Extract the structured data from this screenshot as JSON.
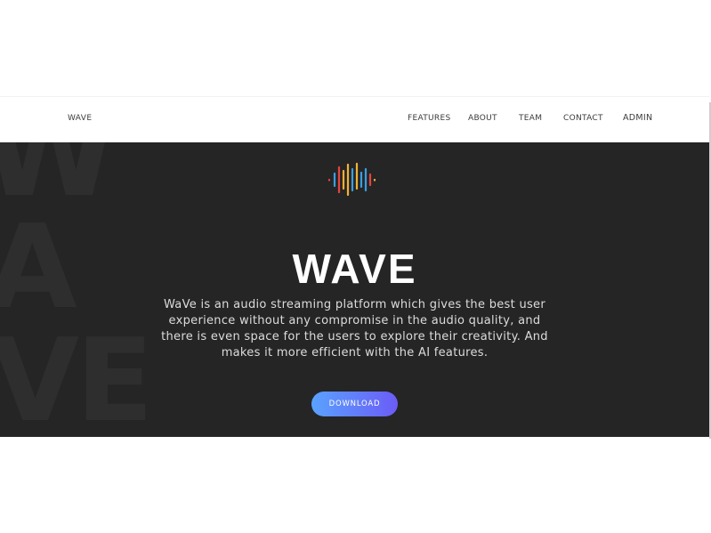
{
  "nav": {
    "brand": "WAVE",
    "items": [
      {
        "label": "FEATURES"
      },
      {
        "label": "ABOUT"
      },
      {
        "label": "TEAM"
      },
      {
        "label": "CONTACT"
      },
      {
        "label": "ADMIN"
      }
    ]
  },
  "hero": {
    "background_letters": [
      "W",
      "A",
      "VE"
    ],
    "logo_icon": "sound-wave-icon",
    "logo_colors": [
      "#e8423d",
      "#f2b134",
      "#3b9de0",
      "#e8423d",
      "#f2b134",
      "#3b9de0"
    ],
    "title": "WAVE",
    "description": "WaVe is an audio streaming platform which gives the best user experience without any compromise in the audio quality, and there is even space for the users to explore their creativity. And makes it more efficient with the AI features.",
    "download_label": "DOWNLOAD",
    "button_gradient": [
      "#5aa2ff",
      "#6b5cf6"
    ]
  },
  "colors": {
    "hero_background": "#252526",
    "text_light": "#ffffff"
  }
}
